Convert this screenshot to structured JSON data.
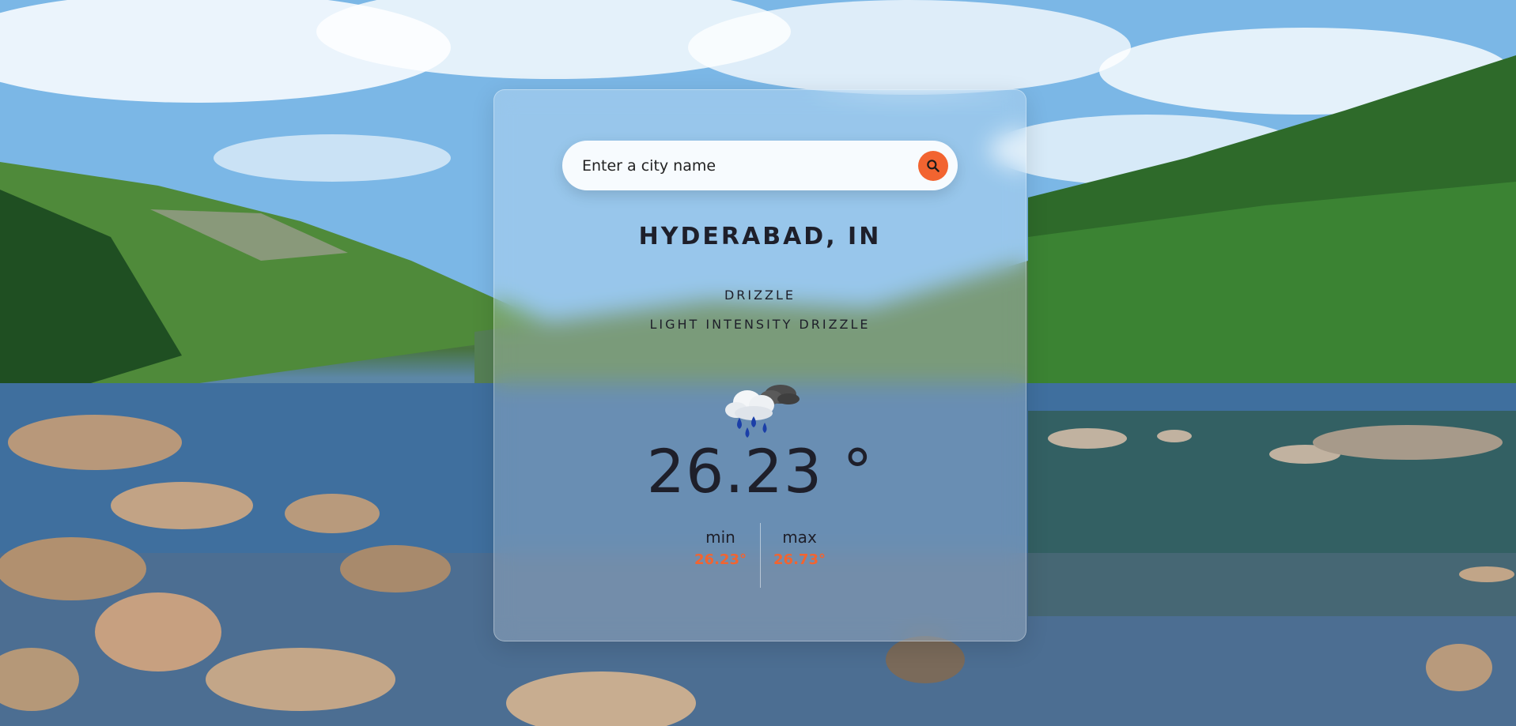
{
  "search": {
    "placeholder": "Enter a city name"
  },
  "location": {
    "city": "HYDERABAD, IN"
  },
  "weather": {
    "condition": "DRIZZLE",
    "description": "LIGHT INTENSITY DRIZZLE",
    "icon": "rain-cloud-icon",
    "temperature": "26.23 °",
    "min_label": "min",
    "min_value": "26.23°",
    "max_label": "max",
    "max_value": "26.73°"
  },
  "colors": {
    "accent": "#f26430",
    "text": "#1e1f2a"
  }
}
